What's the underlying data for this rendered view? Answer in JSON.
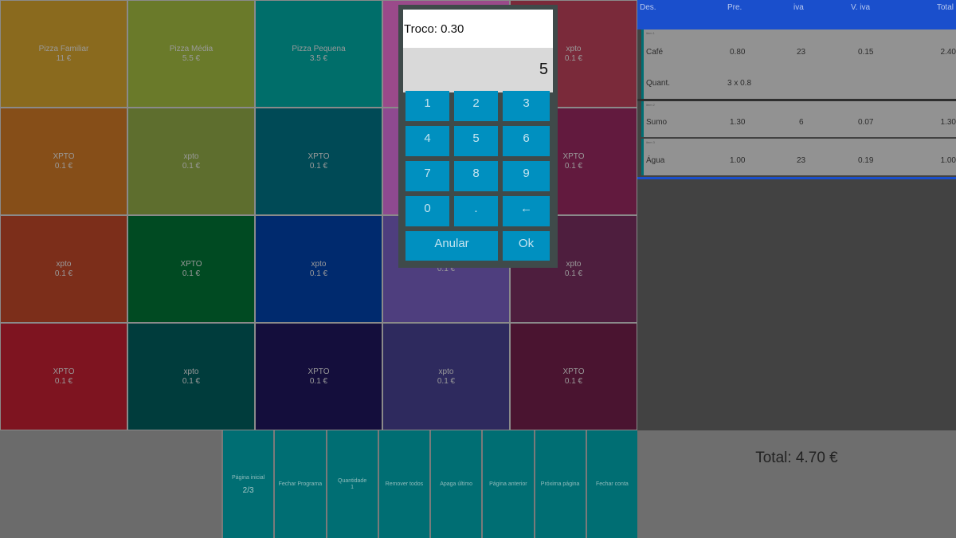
{
  "products": [
    {
      "name": "Pizza Familiar",
      "price": "11 €",
      "color": "#8a6a1e"
    },
    {
      "name": "Pizza Média",
      "price": "5.5 €",
      "color": "#6a7a2a"
    },
    {
      "name": "Pizza Pequena",
      "price": "3.5 €",
      "color": "#006e6a"
    },
    {
      "name": "",
      "price": "",
      "color": "#9a4a8a"
    },
    {
      "name": "xpto",
      "price": "0.1 €",
      "color": "#7a2a3a"
    },
    {
      "name": "XPTO",
      "price": "0.1 €",
      "color": "#864e18"
    },
    {
      "name": "xpto",
      "price": "0.1 €",
      "color": "#5e6e2e"
    },
    {
      "name": "XPTO",
      "price": "0.1 €",
      "color": "#004a56"
    },
    {
      "name": "",
      "price": "",
      "color": "#8e4a90"
    },
    {
      "name": "XPTO",
      "price": "0.1 €",
      "color": "#621a3e"
    },
    {
      "name": "xpto",
      "price": "0.1 €",
      "color": "#7c2e1a"
    },
    {
      "name": "XPTO",
      "price": "0.1 €",
      "color": "#004a22"
    },
    {
      "name": "xpto",
      "price": "0.1 €",
      "color": "#002a6e"
    },
    {
      "name": "",
      "price": "0.1 €",
      "color": "#4e3e7e"
    },
    {
      "name": "xpto",
      "price": "0.1 €",
      "color": "#4e1e3e"
    },
    {
      "name": "XPTO",
      "price": "0.1 €",
      "color": "#7e1420"
    },
    {
      "name": "xpto",
      "price": "0.1 €",
      "color": "#003c3c"
    },
    {
      "name": "XPTO",
      "price": "0.1 €",
      "color": "#140e3c"
    },
    {
      "name": "xpto",
      "price": "0.1 €",
      "color": "#2e2a5e"
    },
    {
      "name": "XPTO",
      "price": "0.1 €",
      "color": "#4a1430"
    }
  ],
  "toolbar": [
    {
      "label": "Página inicial",
      "sub": "2/3"
    },
    {
      "label": "Fechar Programa",
      "sub": ""
    },
    {
      "label": "Quantidade\n1",
      "sub": ""
    },
    {
      "label": "Remover todos",
      "sub": ""
    },
    {
      "label": "Apaga último",
      "sub": ""
    },
    {
      "label": "Página anterior",
      "sub": ""
    },
    {
      "label": "Próxima página",
      "sub": ""
    },
    {
      "label": "Fechar conta",
      "sub": ""
    }
  ],
  "receipt": {
    "headers": {
      "des": "Des.",
      "pre": "Pre.",
      "iva": "iva",
      "viva": "V. iva",
      "total": "Total"
    },
    "items": [
      {
        "tag": "item 1",
        "des": "Café",
        "pre": "0.80",
        "iva": "23",
        "viva": "0.15",
        "total": "2.40",
        "qty_label": "Quant.",
        "qty": "3 x 0.8"
      },
      {
        "tag": "item 2",
        "des": "Sumo",
        "pre": "1.30",
        "iva": "6",
        "viva": "0.07",
        "total": "1.30"
      },
      {
        "tag": "item 3",
        "des": "Água",
        "pre": "1.00",
        "iva": "23",
        "viva": "0.19",
        "total": "1.00"
      }
    ],
    "total": "Total: 4.70 €"
  },
  "dialog": {
    "title": "Troco: 0.30",
    "display": "5",
    "keys": [
      "1",
      "2",
      "3",
      "4",
      "5",
      "6",
      "7",
      "8",
      "9",
      "0",
      ".",
      "←"
    ],
    "cancel": "Anular",
    "ok": "Ok"
  },
  "colors": {
    "accent": "#0090c0",
    "header_blue": "#1a4fcc",
    "teal": "#006e73"
  }
}
